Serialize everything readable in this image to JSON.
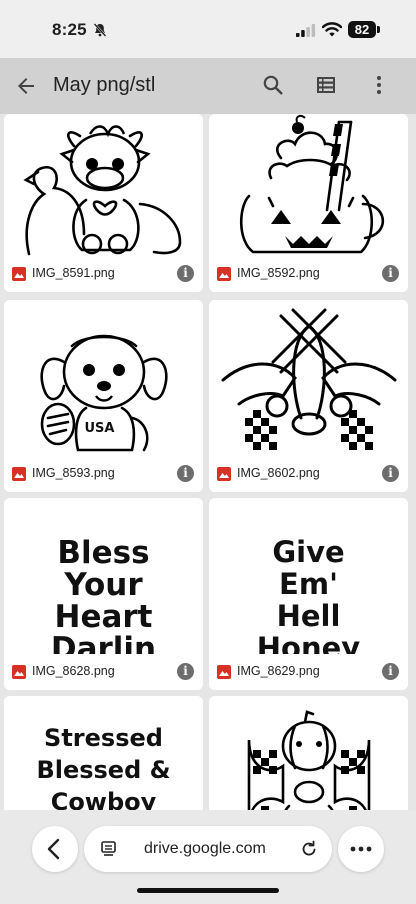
{
  "status_bar": {
    "time": "8:25",
    "battery": "82"
  },
  "app_bar": {
    "title": "May png/stl"
  },
  "files": [
    {
      "name": "IMG_8591.png"
    },
    {
      "name": "IMG_8592.png"
    },
    {
      "name": "IMG_8593.png"
    },
    {
      "name": "IMG_8602.png"
    },
    {
      "name": "IMG_8628.png",
      "thumb_lines": [
        "Bless",
        "Your",
        "Heart",
        "Darlin"
      ]
    },
    {
      "name": "IMG_8629.png",
      "thumb_lines": [
        "Give",
        "Em'",
        "Hell",
        "Honey"
      ]
    },
    {
      "thumb_lines": [
        "Stressed",
        "Blessed &",
        "Cowboy"
      ]
    },
    {}
  ],
  "thumb_text": {
    "usa": "USA"
  },
  "info_glyph": "i",
  "browser": {
    "url": "drive.google.com"
  },
  "icons": {
    "status": [
      "bell-slash-icon",
      "signal-icon",
      "wifi-icon"
    ],
    "app_bar": [
      "back-arrow-icon",
      "search-icon",
      "list-view-icon",
      "more-vert-icon"
    ],
    "browser": [
      "back-chevron-icon",
      "tab-icon",
      "reload-icon",
      "more-horiz-icon"
    ]
  },
  "colors": {
    "app_bar": "#d1d1d1",
    "file_icon": "#d93025",
    "background": "#e6e6e6"
  }
}
